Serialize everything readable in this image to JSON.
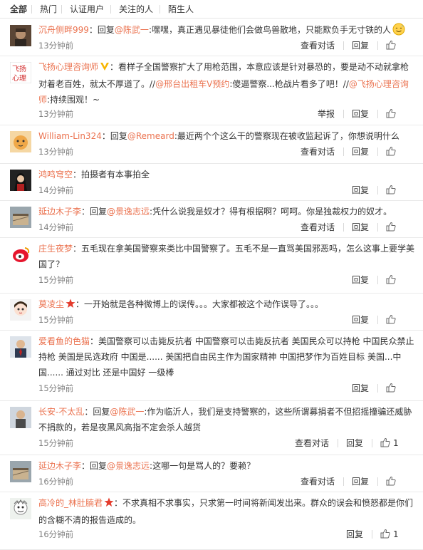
{
  "tabs": [
    "全部",
    "热门",
    "认证用户",
    "关注的人",
    "陌生人"
  ],
  "colors": {
    "username": "#eb7350",
    "accent_link": "#eb7350",
    "meta": "#808080",
    "badge_v": "#f7b500",
    "badge_star": "#e43b2c"
  },
  "labels": {
    "view_dialog": "查看对话",
    "reply": "回复",
    "report": "举报"
  },
  "comments": [
    {
      "user": "沉舟侧畔999",
      "segments": [
        {
          "text": "：回复"
        },
        {
          "text": "@陈武一",
          "type": "mention"
        },
        {
          "text": ":嘿嘿，真正遇见暴徒他们会做鸟兽散地，只能欺负手无寸铁的人"
        }
      ],
      "emoji": "sweat-smile-emoji",
      "time": "13分钟前",
      "actions": [
        "view_dialog",
        "reply"
      ],
      "like_count": ""
    },
    {
      "user": "飞扬心理咨询师",
      "badge": "v-badge",
      "segments": [
        {
          "text": "：看样子全国警察扩大了用枪范围，本意应该是针对暴恐的，要是动不动就拿枪对着老百姓，就太不厚道了。//"
        },
        {
          "text": "@邢台出租车V预约",
          "type": "mention"
        },
        {
          "text": ":傻逼警察...枪战片看多了吧！//"
        },
        {
          "text": "@飞扬心理咨询师",
          "type": "mention"
        },
        {
          "text": ":持续围观！~"
        }
      ],
      "time": "13分钟前",
      "actions": [
        "report",
        "reply"
      ],
      "like_count": ""
    },
    {
      "user": "William-Lin324",
      "segments": [
        {
          "text": "：回复"
        },
        {
          "text": "@Remeard",
          "type": "mention"
        },
        {
          "text": ":最近两个个这么干的警察现在被收监起诉了，你想说明什么"
        }
      ],
      "time": "13分钟前",
      "actions": [
        "view_dialog",
        "reply"
      ],
      "like_count": ""
    },
    {
      "user": "鸿鸣穹空",
      "segments": [
        {
          "text": "：拍摄者有本事拍全"
        }
      ],
      "time": "14分钟前",
      "actions": [
        "reply"
      ],
      "like_count": ""
    },
    {
      "user": "延边木子李",
      "segments": [
        {
          "text": "：回复"
        },
        {
          "text": "@景逸志远",
          "type": "mention"
        },
        {
          "text": ":凭什么说我是奴才？得有根据啊？呵呵。你是独裁权力的奴才。"
        }
      ],
      "time": "14分钟前",
      "actions": [
        "view_dialog",
        "reply"
      ],
      "like_count": ""
    },
    {
      "user": "庄生夜梦",
      "segments": [
        {
          "text": "：五毛现在拿美国警察来类比中国警察了。五毛不是一直骂美国邪恶吗，怎么这事上要学美国了？"
        }
      ],
      "time": "15分钟前",
      "actions": [
        "reply"
      ],
      "like_count": ""
    },
    {
      "user": "莫凌尘",
      "badge": "star-badge",
      "segments": [
        {
          "text": "：一开始就是各种微博上的误传。。。大家都被这个动作误导了。。。"
        }
      ],
      "time": "15分钟前",
      "actions": [
        "reply"
      ],
      "like_count": ""
    },
    {
      "user": "爱看鱼的色猫",
      "segments": [
        {
          "text": "：美国警察可以击毙反抗者 中国警察可以击毙反抗者 美国民众可以持枪 中国民众禁止持枪 美国是民选政府 中国是...... 美国把自由民主作为国家精神 中国把梦作为百姓目标 美国...中国...... 通过对比 还是中国好 一级棒"
        }
      ],
      "time": "15分钟前",
      "actions": [
        "reply"
      ],
      "like_count": ""
    },
    {
      "user": "长安-不太乱",
      "segments": [
        {
          "text": "：回复"
        },
        {
          "text": "@陈武一",
          "type": "mention"
        },
        {
          "text": ":作为临沂人，我们是支持警察的，这些所谓募捐者不但招摇撞骗还威胁不捐款的，若是夜黑风高指不定会杀人越货"
        }
      ],
      "time": "15分钟前",
      "actions": [
        "view_dialog",
        "reply"
      ],
      "like_count": "1"
    },
    {
      "user": "延边木子李",
      "segments": [
        {
          "text": "：回复"
        },
        {
          "text": "@景逸志远",
          "type": "mention"
        },
        {
          "text": ":这哪一句是骂人的？要赖？"
        }
      ],
      "time": "16分钟前",
      "actions": [
        "view_dialog",
        "reply"
      ],
      "like_count": ""
    },
    {
      "user": "高冷的_林肚腩君",
      "badge": "star-badge",
      "segments": [
        {
          "text": "：不求真相不求事实，只求第一时间将新闻发出来。群众的误会和愤怒都是你们的含糊不清的报告造成的。"
        }
      ],
      "time": "16分钟前",
      "actions": [
        "reply"
      ],
      "like_count": "1"
    }
  ]
}
